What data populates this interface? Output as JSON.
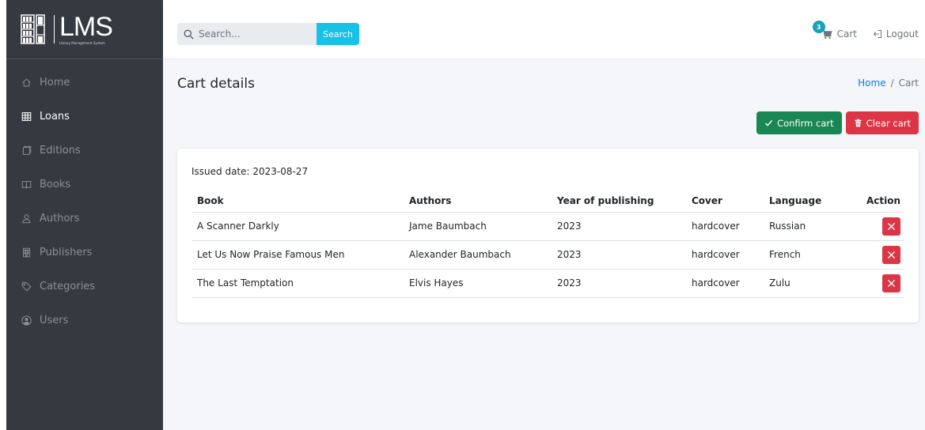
{
  "brand": {
    "title": "LMS",
    "subtitle": "Library Management System"
  },
  "sidebar": {
    "items": [
      {
        "label": "Home",
        "icon": "home-icon",
        "active": false
      },
      {
        "label": "Loans",
        "icon": "table-icon",
        "active": true
      },
      {
        "label": "Editions",
        "icon": "copy-icon",
        "active": false
      },
      {
        "label": "Books",
        "icon": "book-open-icon",
        "active": false
      },
      {
        "label": "Authors",
        "icon": "person-icon",
        "active": false
      },
      {
        "label": "Publishers",
        "icon": "building-icon",
        "active": false
      },
      {
        "label": "Categories",
        "icon": "tag-icon",
        "active": false
      },
      {
        "label": "Users",
        "icon": "user-circle-icon",
        "active": false
      }
    ]
  },
  "header": {
    "search": {
      "placeholder": "Search...",
      "button_label": "Search"
    },
    "cart": {
      "label": "Cart",
      "count": "3"
    },
    "logout_label": "Logout"
  },
  "page": {
    "title": "Cart details",
    "breadcrumb": {
      "home": "Home",
      "separator": "/",
      "current": "Cart"
    },
    "confirm_label": "Confirm cart",
    "clear_label": "Clear cart"
  },
  "cart_table": {
    "issued_date": "Issued date: 2023-08-27",
    "columns": [
      "Book",
      "Authors",
      "Year of publishing",
      "Cover",
      "Language",
      "Action"
    ],
    "rows": [
      [
        "A Scanner Darkly",
        "Jame Baumbach",
        "2023",
        "hardcover",
        "Russian"
      ],
      [
        "Let Us Now Praise Famous Men",
        "Alexander Baumbach",
        "2023",
        "hardcover",
        "French"
      ],
      [
        "The Last Temptation",
        "Elvis Hayes",
        "2023",
        "hardcover",
        "Zulu"
      ]
    ]
  },
  "colors": {
    "sidebar_bg": "#343a40",
    "content_bg": "#f4f6f9",
    "search_button": "#17c1e8",
    "success": "#198754",
    "danger": "#dc3545",
    "badge": "#17a2b8",
    "link": "#007bff"
  }
}
